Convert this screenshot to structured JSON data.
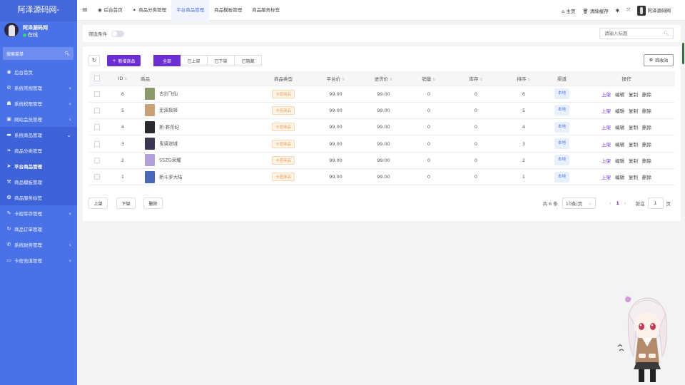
{
  "sidebar": {
    "logo": "阿泽源码网-",
    "user": {
      "name": "阿泽源码网",
      "status": "在线"
    },
    "search_label": "搜索菜单",
    "items": [
      {
        "label": "后台首页",
        "icon": "dashboard-icon",
        "glyph": "◉",
        "arrow": ""
      },
      {
        "label": "系统常规管理",
        "icon": "gear-icon",
        "glyph": "⚙",
        "arrow": "‹"
      },
      {
        "label": "系统权限管理",
        "icon": "users-icon",
        "glyph": "☗",
        "arrow": "‹"
      },
      {
        "label": "网站会员管理",
        "icon": "member-icon",
        "glyph": "▣",
        "arrow": "‹"
      },
      {
        "label": "系统商品管理",
        "icon": "product-icon",
        "glyph": "▬",
        "arrow": "⌄"
      },
      {
        "label": "商品分类管理",
        "icon": "leaf-icon",
        "glyph": "❧",
        "arrow": ""
      },
      {
        "label": "平台商品管理",
        "icon": "paper-plane-icon",
        "glyph": "➤",
        "arrow": ""
      },
      {
        "label": "商品模板管理",
        "icon": "wrench-icon",
        "glyph": "⚒",
        "arrow": ""
      },
      {
        "label": "商品服务标签",
        "icon": "tag-icon",
        "glyph": "❂",
        "arrow": ""
      },
      {
        "label": "卡密库存管理",
        "icon": "key-icon",
        "glyph": "✎",
        "arrow": "‹"
      },
      {
        "label": "商品订单管理",
        "icon": "order-icon",
        "glyph": "↻",
        "arrow": ""
      },
      {
        "label": "系统财务管理",
        "icon": "finance-icon",
        "glyph": "✆",
        "arrow": "‹"
      },
      {
        "label": "卡密充值管理",
        "icon": "monitor-icon",
        "glyph": "▭",
        "arrow": "‹"
      }
    ]
  },
  "topbar": {
    "tabs": [
      {
        "label": "后台首页",
        "icon": "dashboard-icon",
        "glyph": "◉"
      },
      {
        "label": "商品分类管理",
        "icon": "leaf-icon",
        "glyph": "❧"
      },
      {
        "label": "平台商品管理",
        "icon": "",
        "glyph": ""
      },
      {
        "label": "商品模板管理",
        "icon": "",
        "glyph": ""
      },
      {
        "label": "商品服务标签",
        "icon": "",
        "glyph": ""
      }
    ],
    "home": "主页",
    "clear_cache": "清除缓存",
    "username": "阿泽源码网"
  },
  "filter": {
    "label": "筛选条件",
    "search_placeholder": "请输入标题"
  },
  "toolbar": {
    "add_label": "新增商品",
    "status_tabs": [
      "全部",
      "已上架",
      "已下架",
      "已隐藏"
    ],
    "recycle_label": "回收站"
  },
  "table": {
    "columns": [
      "ID",
      "商品",
      "商品类型",
      "平台价",
      "进货价",
      "销量",
      "库存",
      "排序",
      "渠道",
      "操作"
    ],
    "rows": [
      {
        "id": "6",
        "name": "古剑飞仙",
        "type": "卡密商品",
        "price": "99.00",
        "cost": "99.00",
        "sales": "0",
        "stock": "0",
        "sort": "6",
        "channel": "本地",
        "img": "#8a9a6a"
      },
      {
        "id": "5",
        "name": "无双极姬",
        "type": "卡密商品",
        "price": "99.00",
        "cost": "99.00",
        "sales": "0",
        "stock": "0",
        "sort": "5",
        "channel": "本地",
        "img": "#c9a078"
      },
      {
        "id": "4",
        "name": "新·葬荒纪",
        "type": "卡密商品",
        "price": "99.00",
        "cost": "99.00",
        "sales": "0",
        "stock": "0",
        "sort": "4",
        "channel": "本地",
        "img": "#2a2a2e"
      },
      {
        "id": "3",
        "name": "鬼语迷城",
        "type": "卡密商品",
        "price": "99.00",
        "cost": "99.00",
        "sales": "0",
        "stock": "0",
        "sort": "3",
        "channel": "本地",
        "img": "#3a3850"
      },
      {
        "id": "2",
        "name": "SSZG荣耀",
        "type": "卡密商品",
        "price": "99.00",
        "cost": "99.00",
        "sales": "0",
        "stock": "0",
        "sort": "2",
        "channel": "本地",
        "img": "#b4a0d8"
      },
      {
        "id": "1",
        "name": "新斗罗大陆",
        "type": "卡密商品",
        "price": "99.00",
        "cost": "99.00",
        "sales": "0",
        "stock": "0",
        "sort": "1",
        "channel": "本地",
        "img": "#4a6ab8"
      }
    ],
    "actions": [
      "上架",
      "编辑",
      "复制",
      "删除"
    ]
  },
  "bulk": {
    "up": "上架",
    "down": "下架",
    "delete": "删除"
  },
  "pagination": {
    "total": "共 6 条",
    "page_size": "10条/页",
    "current": "1",
    "goto_label": "前往",
    "goto_value": "1",
    "page_suffix": "页"
  },
  "colors": {
    "sidebar": "#4a72e6",
    "accent": "#6d2fd4",
    "tab_active": "#4a72e6"
  }
}
